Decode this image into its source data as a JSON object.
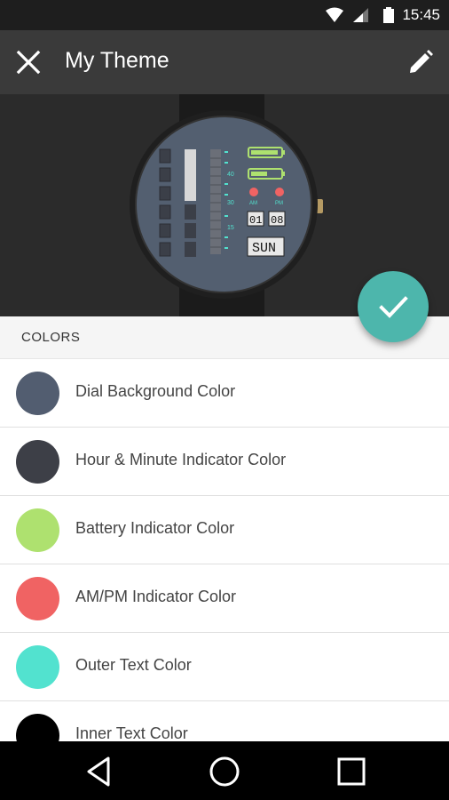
{
  "status_bar": {
    "time": "15:45",
    "icons": [
      "wifi-icon",
      "signal-icon",
      "battery-icon"
    ]
  },
  "toolbar": {
    "title": "My Theme",
    "close_icon": "close-icon",
    "edit_icon": "pencil-icon"
  },
  "preview": {
    "watch_texts": {
      "am": "AM",
      "pm": "PM",
      "day": "01",
      "month": "08",
      "weekday": "SUN",
      "ticks": [
        "40",
        "30",
        "15"
      ]
    }
  },
  "fab": {
    "icon": "check-icon"
  },
  "colors_section": {
    "header": "COLORS",
    "items": [
      {
        "label": "Dial Background Color",
        "color": "#525d70"
      },
      {
        "label": "Hour & Minute Indicator Color",
        "color": "#3d3f47"
      },
      {
        "label": "Battery Indicator Color",
        "color": "#aee16f"
      },
      {
        "label": "AM/PM Indicator Color",
        "color": "#f06363"
      },
      {
        "label": "Outer Text Color",
        "color": "#52e2cf"
      },
      {
        "label": "Inner Text Color",
        "color": "#000000"
      }
    ]
  },
  "nav_bar": {
    "icons": [
      "back-icon",
      "home-icon",
      "recents-icon"
    ]
  }
}
